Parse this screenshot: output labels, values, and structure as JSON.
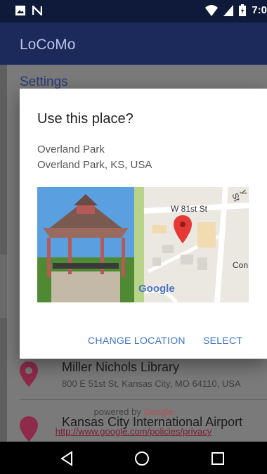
{
  "status_bar": {
    "time": "7:0",
    "left_icons": [
      "image-icon",
      "n-icon"
    ],
    "right_icons": [
      "wifi-icon",
      "signal-icon",
      "battery-icon"
    ]
  },
  "app_bar": {
    "title": "LoCoMo"
  },
  "screen": {
    "section_title": "Settings"
  },
  "dialog": {
    "title": "Use this place?",
    "place_name": "Overland Park",
    "place_address": "Overland Park, KS, USA",
    "map": {
      "street_label_1": "W 81st St",
      "street_label_2": "Con",
      "street_label_3": "y St",
      "logo_text": "Google"
    },
    "buttons": {
      "change": "CHANGE LOCATION",
      "select": "SELECT"
    }
  },
  "results": [
    {
      "name": "Miller Nichols Library",
      "address": "800 E 51st St, Kansas City, MO 64110, USA"
    },
    {
      "name": "Kansas City International Airport"
    }
  ],
  "footer": {
    "powered_by": "powered by",
    "powered_brand": "Google",
    "policy_link": "http://www.google.com/policies/privacy"
  },
  "colors": {
    "app_bar": "#1b2a5a",
    "accent": "#3a74c8",
    "pin": "#b0345a"
  }
}
